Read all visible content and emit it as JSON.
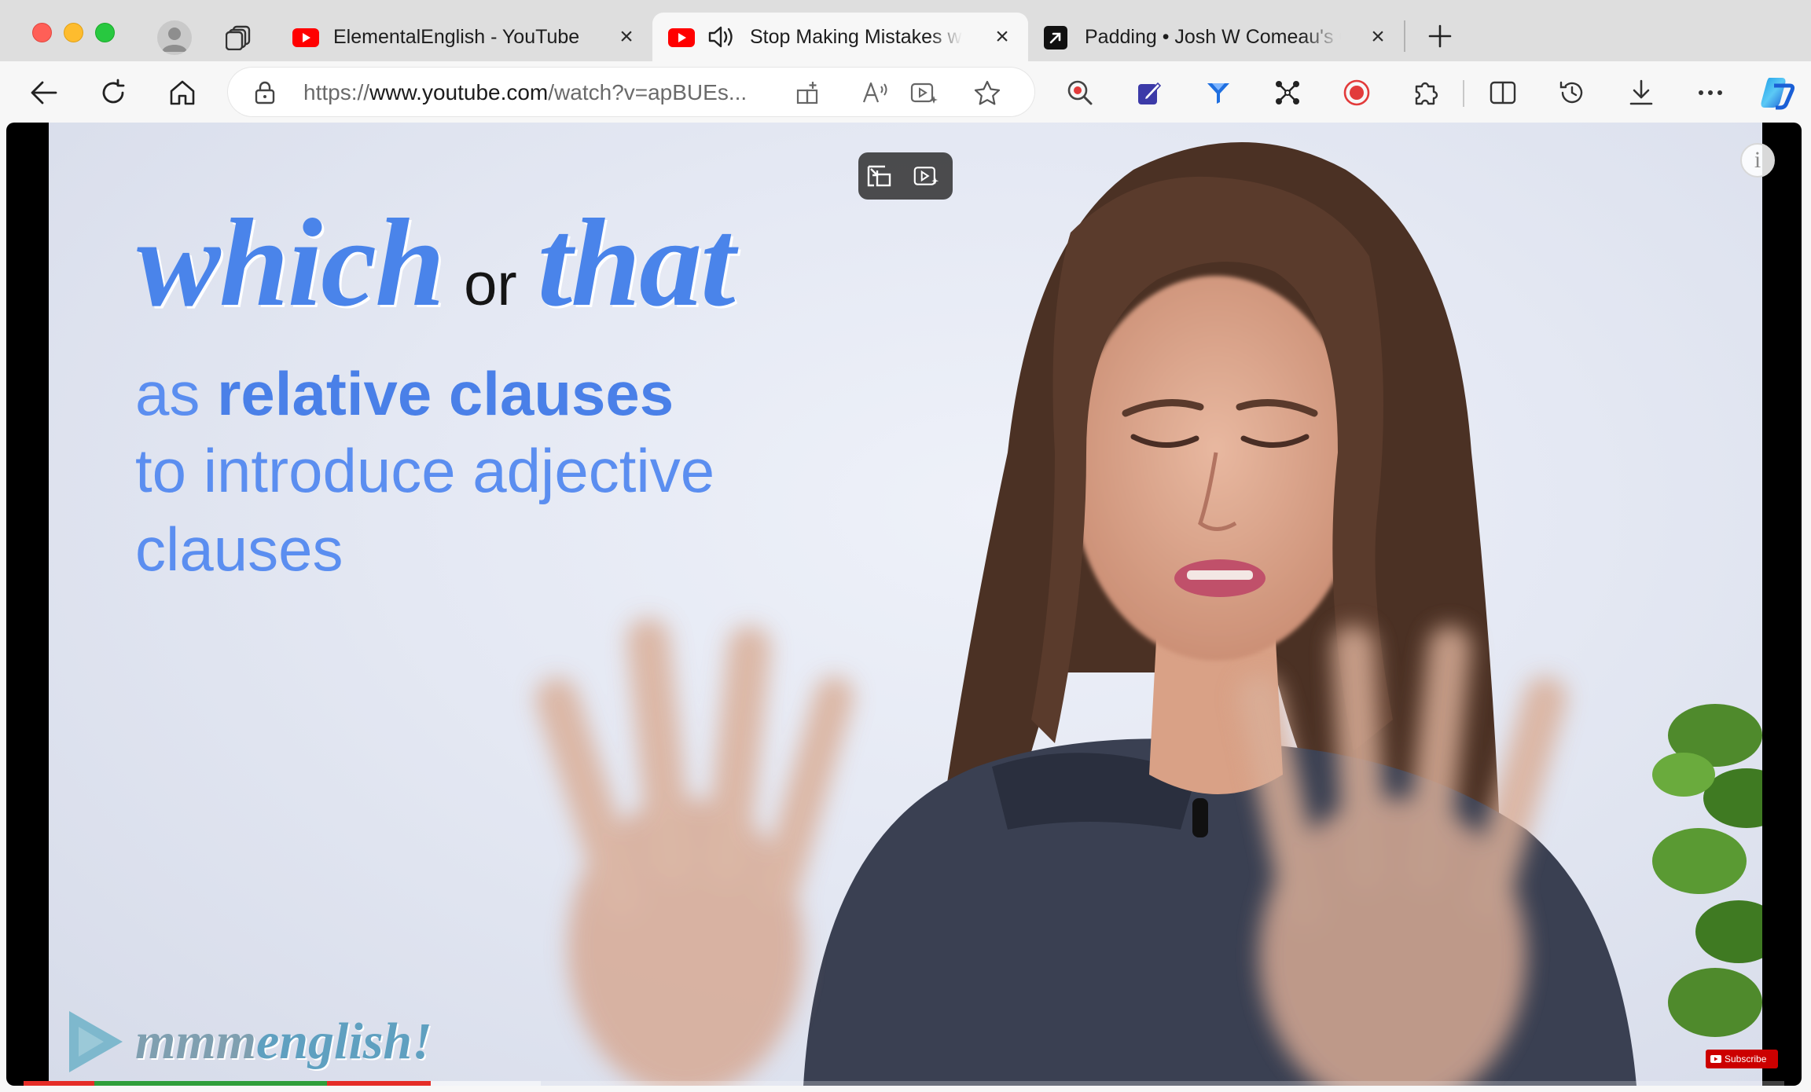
{
  "tabs": [
    {
      "title": "ElementalEnglish - YouTube",
      "favicon": "youtube-icon",
      "active": false
    },
    {
      "title": "Stop Making Mistakes with",
      "favicon": "youtube-icon",
      "audio": "speaker-icon",
      "active": true
    },
    {
      "title": "Padding • Josh W Comeau's C",
      "favicon": "arrow-link-icon",
      "active": false
    }
  ],
  "address_bar": {
    "url_scheme": "https://",
    "url_host": "www.youtube.com",
    "url_rest": "/watch?v=apBUEs..."
  },
  "video": {
    "title_word1": "which",
    "title_or": "or",
    "title_word2": "that",
    "line2_prefix": "as ",
    "line2_bold": "relative clauses",
    "line3": "to introduce adjective",
    "line4": "clauses",
    "logo_part1": "mmm",
    "logo_part2": "english!",
    "subscribe_label": "Subscribe",
    "info_label": "i",
    "progress_fraction": 0.19
  },
  "colors": {
    "accent_blue": "#4a84ea",
    "youtube_red": "#ff0000",
    "progress_red": "#e52d27",
    "progress_green": "#2f9e3a"
  }
}
